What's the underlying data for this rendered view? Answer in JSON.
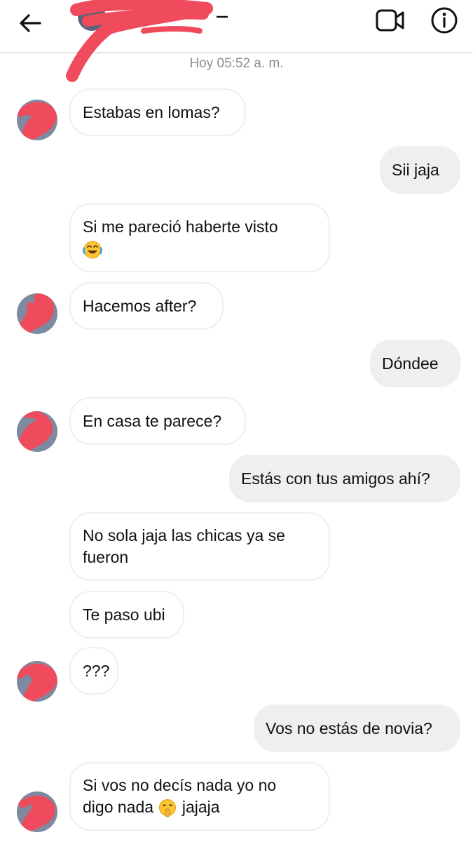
{
  "header": {
    "back_icon": "arrow-left-icon",
    "video_icon": "video-call-icon",
    "info_icon": "info-icon",
    "redaction_color": "#f04b5c"
  },
  "conversation": {
    "timestamp": "Hoy 05:52 a. m.",
    "messages": [
      {
        "from": "them",
        "lines": [
          "Estabas en lomas?"
        ]
      },
      {
        "from": "me",
        "lines": [
          "Sii jaja"
        ]
      },
      {
        "from": "them",
        "lines": [
          "Si me pareció haberte visto"
        ],
        "emoji": "face-with-tears-of-joy"
      },
      {
        "from": "them",
        "lines": [
          "Hacemos after?"
        ]
      },
      {
        "from": "me",
        "lines": [
          "Dóndee"
        ]
      },
      {
        "from": "them",
        "lines": [
          "En casa te parece?"
        ]
      },
      {
        "from": "me",
        "lines": [
          "Estás con tus amigos ahí?"
        ]
      },
      {
        "from": "them",
        "lines": [
          "No sola jaja las chicas ya se",
          "fueron"
        ]
      },
      {
        "from": "them",
        "lines": [
          "Te paso ubi"
        ]
      },
      {
        "from": "them",
        "lines": [
          "???"
        ]
      },
      {
        "from": "me",
        "lines": [
          "Vos no estás de novia?"
        ]
      },
      {
        "from": "them",
        "lines": [
          "Si vos no decís nada yo no",
          "digo nada",
          "jajaja"
        ],
        "emoji": "shushing-face"
      }
    ]
  },
  "colors": {
    "incoming_bubble_border": "#efefef",
    "outgoing_bubble_bg": "#efefef",
    "timestamp_text": "#8e8e8e"
  }
}
